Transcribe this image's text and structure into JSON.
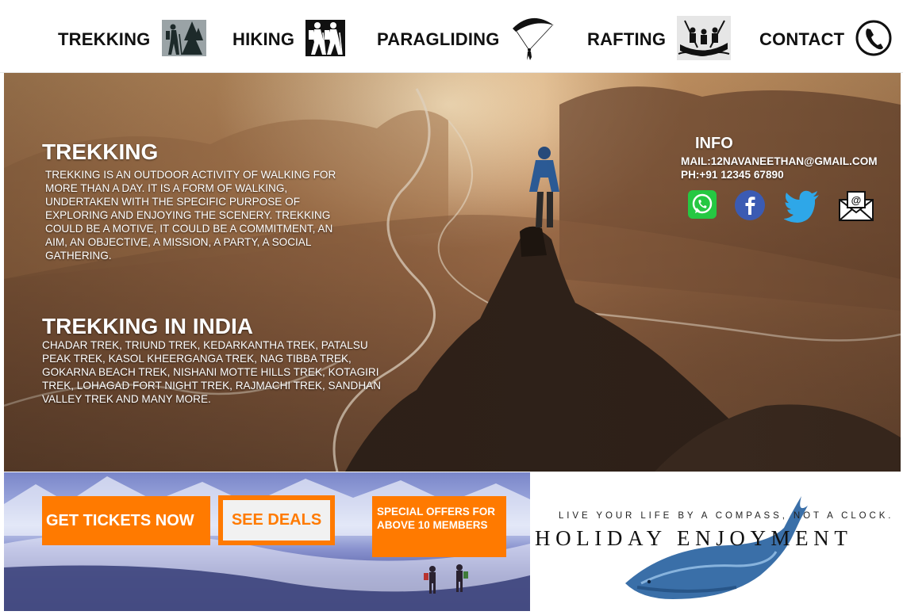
{
  "nav": [
    {
      "label": "TREKKING",
      "icon": "trekking-icon"
    },
    {
      "label": "HIKING",
      "icon": "hiking-icon"
    },
    {
      "label": "PARAGLIDING",
      "icon": "paragliding-icon"
    },
    {
      "label": "RAFTING",
      "icon": "rafting-icon"
    },
    {
      "label": "CONTACT",
      "icon": "phone-icon"
    }
  ],
  "hero": {
    "trekking": {
      "title": "TREKKING",
      "body": "TREKKING IS AN OUTDOOR ACTIVITY OF WALKING FOR MORE THAN A DAY. IT IS A FORM OF WALKING, UNDERTAKEN WITH THE SPECIFIC PURPOSE OF EXPLORING AND ENJOYING THE SCENERY. TREKKING COULD BE A MOTIVE, IT COULD BE A COMMITMENT, AN AIM, AN OBJECTIVE, A MISSION, A PARTY, A SOCIAL GATHERING."
    },
    "india": {
      "title": "TREKKING IN INDIA",
      "body": "CHADAR TREK, TRIUND TREK, KEDARKANTHA TREK, PATALSU PEAK TREK, KASOL KHEERGANGA TREK, NAG TIBBA TREK, GOKARNA BEACH TREK, NISHANI MOTTE HILLS TREK, KOTAGIRI TREK, LOHAGAD FORT NIGHT TREK, RAJMACHI TREK, SANDHAN VALLEY TREK AND MANY MORE."
    }
  },
  "info": {
    "title": "INFO",
    "mail": "MAIL:12NAVANEETHAN@GMAIL.COM",
    "phone": "PH:+91 12345 67890",
    "social": [
      "whatsapp-icon",
      "facebook-icon",
      "twitter-icon",
      "email-icon"
    ]
  },
  "banner": {
    "tickets": "GET TICKETS NOW",
    "deals": "SEE DEALS",
    "offer": "SPECIAL OFFERS FOR ABOVE 10 MEMBERS"
  },
  "promo": {
    "tagline": "LIVE YOUR LIFE BY A COMPASS, NOT A CLOCK.",
    "name": "HOLIDAY ENJOYMENT"
  },
  "colors": {
    "accent": "#ff7a00",
    "nav_text": "#111111",
    "hero_text": "#ffffff"
  }
}
